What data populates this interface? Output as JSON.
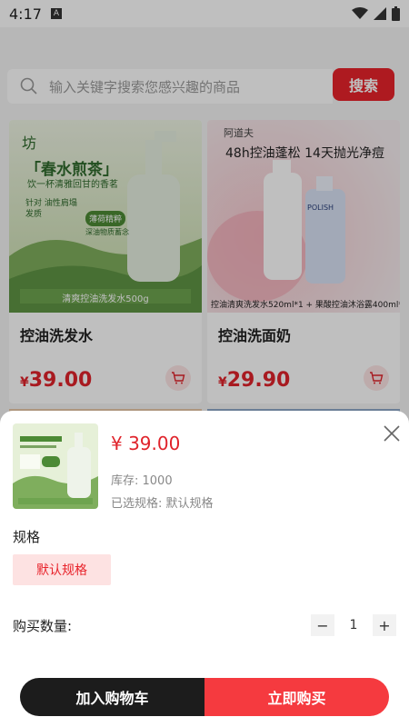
{
  "status": {
    "time": "4:17"
  },
  "search": {
    "placeholder": "输入关键字搜索您感兴趣的商品",
    "button": "搜索"
  },
  "products": [
    {
      "name": "控油洗发水",
      "price": "39.00",
      "currency": "¥",
      "image_text": {
        "brand": "坊",
        "headline": "「春水煎茶」",
        "sub": "饮一杯清雅回甘的香茗",
        "tag1": "针对 油性肩塌 发质",
        "tag2": "薄荷精粹",
        "tag3": "深油物质蓄念",
        "label": "清爽控油洗发水500g"
      }
    },
    {
      "name": "控油洗面奶",
      "price": "29.90",
      "currency": "¥",
      "image_text": {
        "brand": "阿道夫",
        "headline": "48h控油蓬松 14天抛光净痘",
        "bottle": "POLISH",
        "label": "控油清爽洗发水520ml*1 + 果酸控油沐浴露400ml*1"
      }
    }
  ],
  "sheet": {
    "price": "¥ 39.00",
    "stock_label": "库存: ",
    "stock_value": "1000",
    "selected_label": "已选规格: ",
    "selected_value": "默认规格",
    "spec_title": "规格",
    "spec_option": "默认规格",
    "qty_label": "购买数量:",
    "qty_value": "1",
    "qty_minus": "−",
    "qty_plus": "+",
    "add_cart": "加入购物车",
    "buy_now": "立即购买"
  },
  "colors": {
    "accent": "#e8232b",
    "dark": "#1c1c1c",
    "chip_bg": "#fde2e2"
  }
}
